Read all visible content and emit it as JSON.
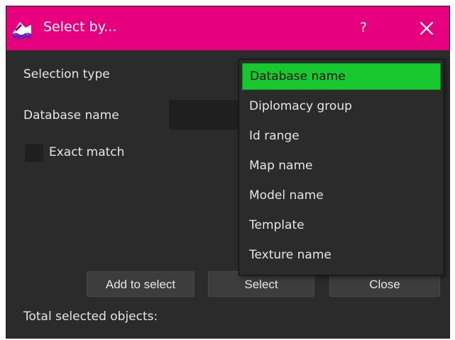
{
  "window": {
    "title": "Select by...",
    "help_label": "?",
    "accent_color": "#e6007e"
  },
  "form": {
    "selection_type_label": "Selection type",
    "database_name_label": "Database name",
    "database_name_value": "",
    "exact_match_label": "Exact match",
    "exact_match_checked": false
  },
  "dropdown": {
    "selected_index": 0,
    "selected_color": "#17c92e",
    "options": [
      "Database name",
      "Diplomacy group",
      "Id range",
      "Map name",
      "Model name",
      "Template",
      "Texture name"
    ]
  },
  "buttons": {
    "add_to_select": "Add to select",
    "select": "Select",
    "close": "Close"
  },
  "status": {
    "total_selected_label": "Total selected objects:"
  }
}
